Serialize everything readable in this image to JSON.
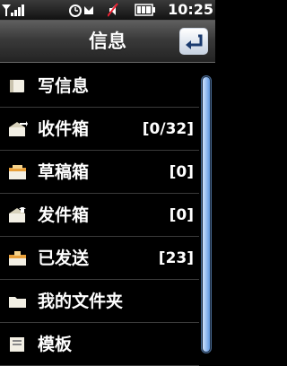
{
  "status_bar": {
    "time": "10:25",
    "icons": [
      "signal-icon",
      "alarm-icon",
      "sound-off-icon",
      "battery-icon"
    ]
  },
  "header": {
    "title": "信息",
    "back_icon": "back-arrow-icon"
  },
  "menu": [
    {
      "label": "写信息",
      "count": "",
      "icon": "write-message-icon"
    },
    {
      "label": "收件箱",
      "count": "[0/32]",
      "icon": "inbox-icon"
    },
    {
      "label": "草稿箱",
      "count": "[0]",
      "icon": "drafts-icon"
    },
    {
      "label": "发件箱",
      "count": "[0]",
      "icon": "outbox-icon"
    },
    {
      "label": "已发送",
      "count": "[23]",
      "icon": "sent-icon"
    },
    {
      "label": "我的文件夹",
      "count": "",
      "icon": "folder-icon"
    },
    {
      "label": "模板",
      "count": "",
      "icon": "template-icon"
    }
  ],
  "colors": {
    "accent": "#5f97e0",
    "icon": "#f2efe4"
  }
}
